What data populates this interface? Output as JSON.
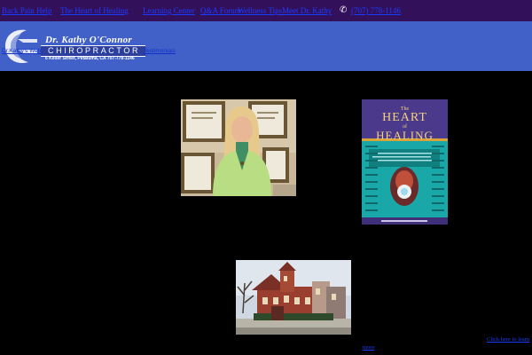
{
  "topnav": {
    "items": [
      {
        "label": "Back Pain Help"
      },
      {
        "label": "The Heart of Healing"
      },
      {
        "label": "Learning Center"
      },
      {
        "label": "Q&A Forum"
      },
      {
        "label": "Wellness Tips"
      },
      {
        "label": "Meet Dr. Kathy"
      }
    ],
    "phone_icon": "phone-icon",
    "phone": "(707) 778-1146"
  },
  "logo": {
    "name": "Dr. Kathy O'Connor",
    "title": "CHIROPRACTOR",
    "address": "6 Keller Street, Petaluma, CA  707-778-1146"
  },
  "subnav": {
    "left_text": "Dr.Kathy's Web",
    "right_text": "Testimonials"
  },
  "images": {
    "portrait": "Dr. Kathy O'Connor portrait",
    "book": {
      "title_line1": "The",
      "title_line2": "HEART",
      "title_line3": "of",
      "title_line4": "HEALING"
    },
    "building": "Office building"
  },
  "bottom_link": {
    "text_line1": "Click here to learn",
    "text_line2": "more"
  },
  "colors": {
    "topbar": "#33105a",
    "header": "#4161c9",
    "link": "#1a3cff",
    "background": "#000000"
  }
}
